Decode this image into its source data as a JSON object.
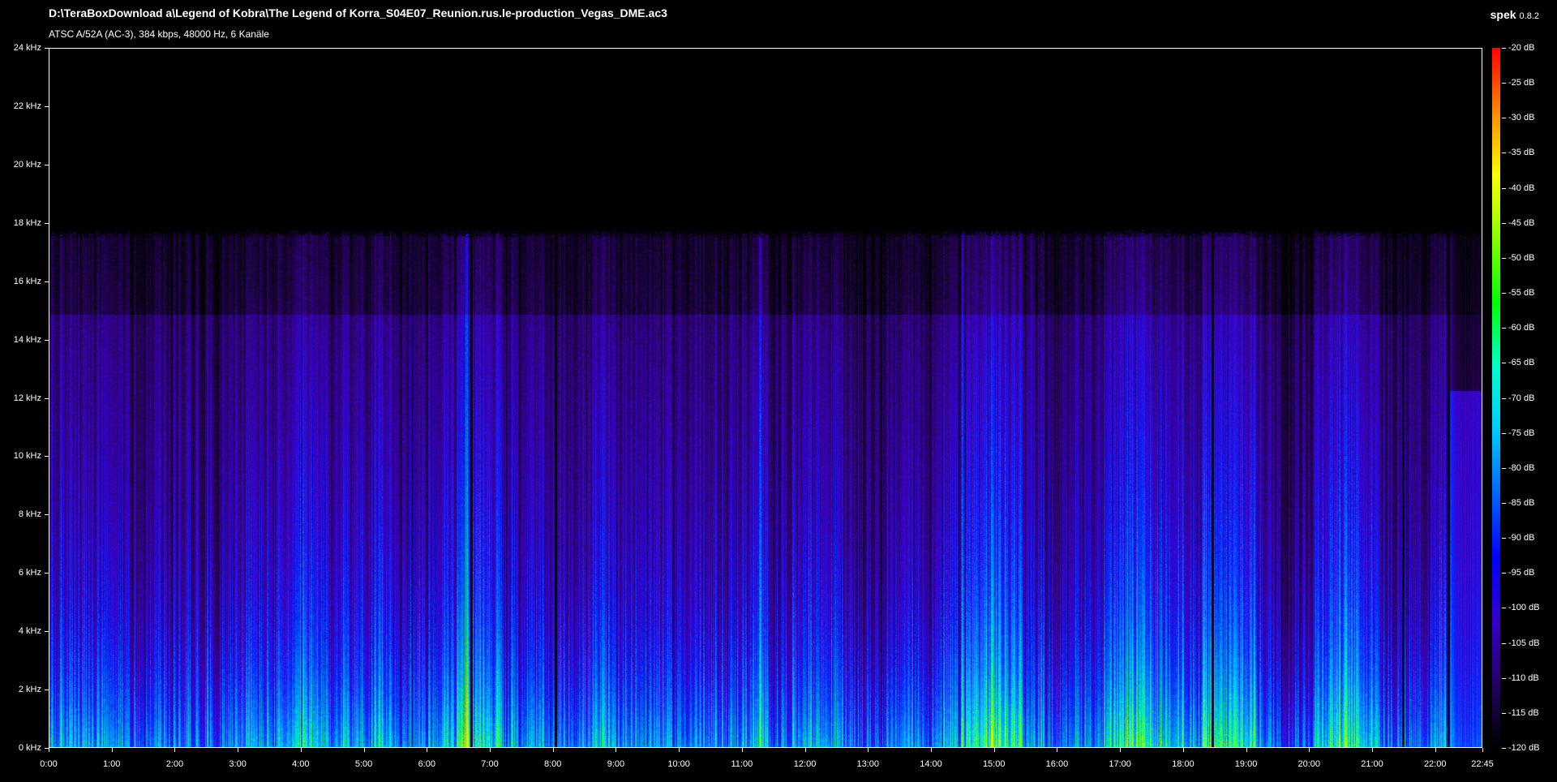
{
  "window": {
    "file_path": "D:\\TeraBoxDownload a\\Legend of Kobra\\The Legend of Korra_S04E07_Reunion.rus.le-production_Vegas_DME.ac3",
    "file_info": "ATSC A/52A (AC-3), 384 kbps, 48000 Hz, 6 Kanäle",
    "app_name": "spek",
    "app_version": "0.8.2"
  },
  "frequency_axis": {
    "labels": [
      "0 kHz",
      "2 kHz",
      "4 kHz",
      "6 kHz",
      "8 kHz",
      "10 kHz",
      "12 kHz",
      "14 kHz",
      "16 kHz",
      "18 kHz",
      "20 kHz",
      "22 kHz",
      "24 kHz"
    ],
    "values_khz": [
      0,
      2,
      4,
      6,
      8,
      10,
      12,
      14,
      16,
      18,
      20,
      22,
      24
    ],
    "max_khz": 24
  },
  "time_axis": {
    "labels": [
      "0:00",
      "1:00",
      "2:00",
      "3:00",
      "4:00",
      "5:00",
      "6:00",
      "7:00",
      "8:00",
      "9:00",
      "10:00",
      "11:00",
      "12:00",
      "13:00",
      "14:00",
      "15:00",
      "16:00",
      "17:00",
      "18:00",
      "19:00",
      "20:00",
      "21:00",
      "22:00",
      "22:45"
    ],
    "values_sec": [
      0,
      60,
      120,
      180,
      240,
      300,
      360,
      420,
      480,
      540,
      600,
      660,
      720,
      780,
      840,
      900,
      960,
      1020,
      1080,
      1140,
      1200,
      1260,
      1320,
      1365
    ],
    "duration_sec": 1365
  },
  "db_scale": {
    "labels": [
      "-20 dB",
      "-25 dB",
      "-30 dB",
      "-35 dB",
      "-40 dB",
      "-45 dB",
      "-50 dB",
      "-55 dB",
      "-60 dB",
      "-65 dB",
      "-70 dB",
      "-75 dB",
      "-80 dB",
      "-85 dB",
      "-90 dB",
      "-95 dB",
      "-100 dB",
      "-105 dB",
      "-110 dB",
      "-115 dB",
      "-120 dB"
    ],
    "values_db": [
      -20,
      -25,
      -30,
      -35,
      -40,
      -45,
      -50,
      -55,
      -60,
      -65,
      -70,
      -75,
      -80,
      -85,
      -90,
      -95,
      -100,
      -105,
      -110,
      -115,
      -120
    ],
    "colors": [
      "#ff0000",
      "#ff8800",
      "#ffff00",
      "#88ff00",
      "#00ff00",
      "#00ffcc",
      "#00ccff",
      "#0066ff",
      "#0000ff",
      "#3300cc",
      "#220066",
      "#000000"
    ]
  },
  "spectrum": {
    "cutoff_khz": 17.5,
    "silent_marks_sec": [
      402,
      482,
      1108,
      1290,
      1333
    ],
    "bright_marks_sec": [
      397,
      677,
      870,
      935,
      1336
    ]
  }
}
